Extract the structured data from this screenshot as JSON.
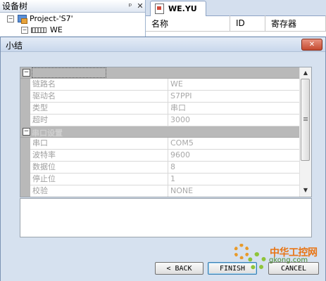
{
  "device_tree": {
    "title": "设备树",
    "pin_glyph": "ᵖ",
    "close_glyph": "✕",
    "items": [
      {
        "label": "Project-'S7'",
        "expander": "−"
      },
      {
        "label": "WE",
        "expander": "−"
      }
    ]
  },
  "document": {
    "tab_label": "WE.YU",
    "columns": [
      "名称",
      "ID",
      "寄存器"
    ]
  },
  "dialog": {
    "title": "小结",
    "close_glyph": "✕",
    "categories": [
      {
        "name": "",
        "expander": "−",
        "properties": [
          {
            "name": "链路名",
            "value": "WE"
          },
          {
            "name": "驱动名",
            "value": "S7PPI"
          },
          {
            "name": "类型",
            "value": "串口"
          },
          {
            "name": "超时",
            "value": "3000"
          }
        ]
      },
      {
        "name": "串口设置",
        "expander": "−",
        "properties": [
          {
            "name": "串口",
            "value": "COM5"
          },
          {
            "name": "波特率",
            "value": "9600"
          },
          {
            "name": "数据位",
            "value": "8"
          },
          {
            "name": "停止位",
            "value": "1"
          },
          {
            "name": "校验",
            "value": "NONE"
          }
        ]
      }
    ],
    "scroll": {
      "up": "▲",
      "down": "▼"
    },
    "buttons": {
      "back": "< BACK",
      "finish": "FINISH",
      "cancel": "CANCEL"
    }
  },
  "watermark": {
    "name": "中华工控网",
    "url": "gkong.com"
  },
  "colors": {
    "dialog_bg": "#d6e1ef",
    "category_bg": "#b9b9b9",
    "close_button": "#c44a30",
    "watermark_orange": "#e87515",
    "watermark_green": "#4a8a2a"
  }
}
